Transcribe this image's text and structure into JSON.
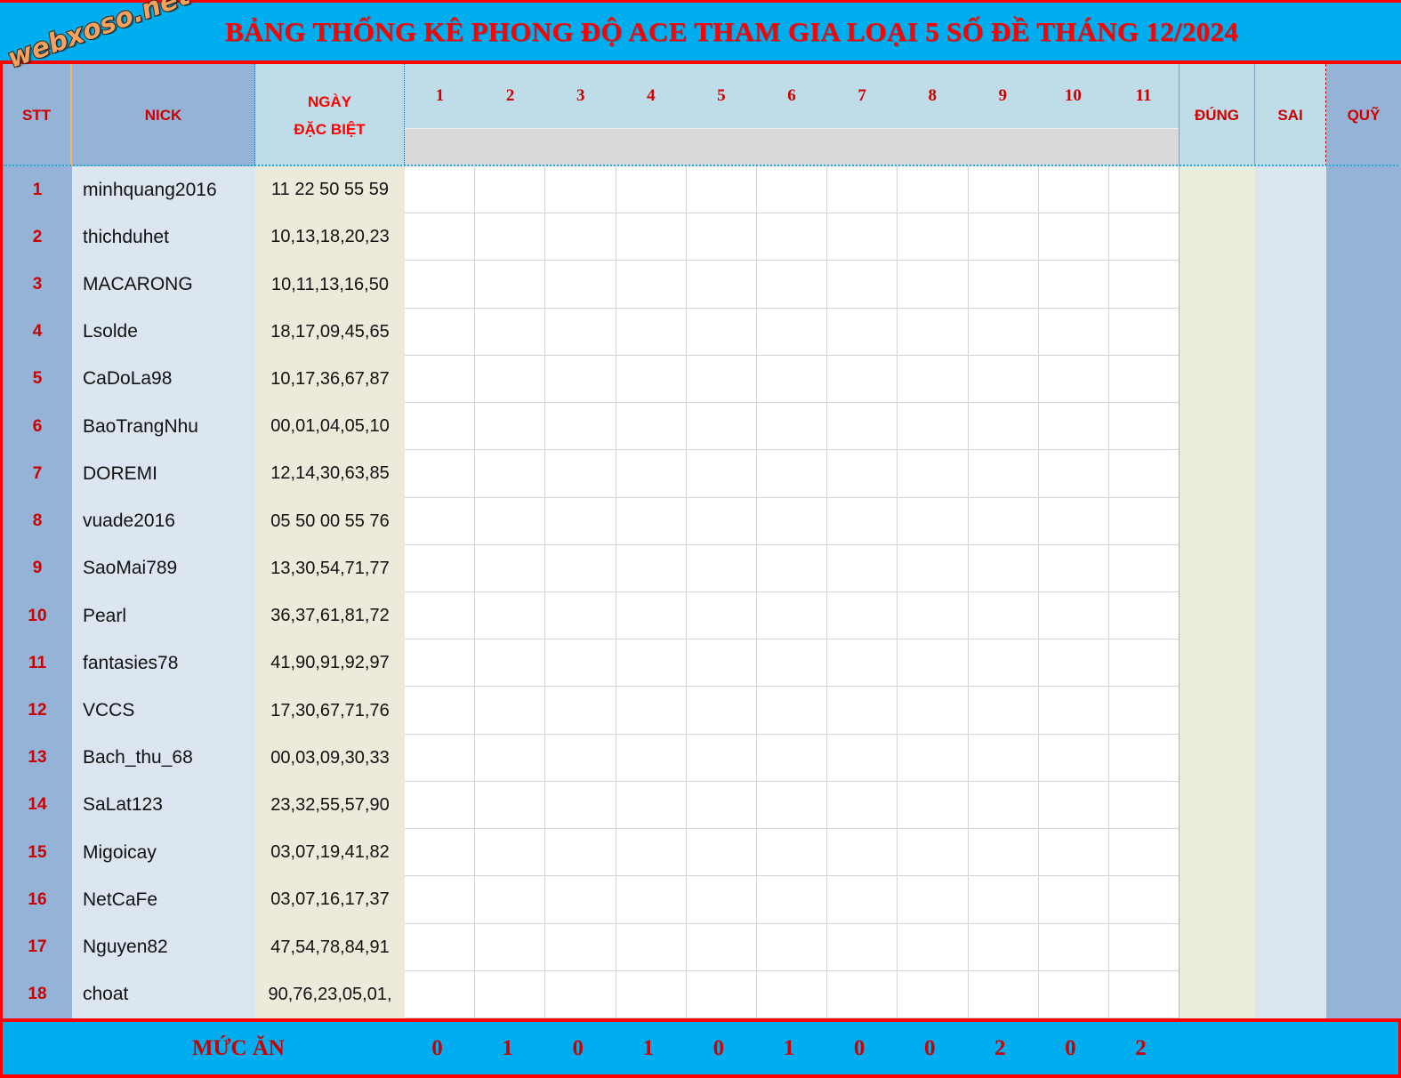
{
  "watermark": {
    "text": "webxoso.net"
  },
  "title": "BẢNG THỐNG KÊ PHONG ĐỘ ACE THAM GIA LOẠI 5 SỐ ĐỀ THÁNG 12/2024",
  "header": {
    "stt": "STT",
    "nick": "NICK",
    "ngay_line1": "NGÀY",
    "ngay_line2": "ĐẶC BIỆT",
    "day_columns": [
      "1",
      "2",
      "3",
      "4",
      "5",
      "6",
      "7",
      "8",
      "9",
      "10",
      "11"
    ],
    "dung": "ĐÚNG",
    "sai": "SAI",
    "quy": "QUỸ"
  },
  "rows": [
    {
      "stt": "1",
      "nick": "minhquang2016",
      "ngay": "11 22 50 55 59",
      "dung": "",
      "sai": "",
      "quy": ""
    },
    {
      "stt": "2",
      "nick": "thichduhet",
      "ngay": "10,13,18,20,23",
      "dung": "",
      "sai": "",
      "quy": ""
    },
    {
      "stt": "3",
      "nick": "MACARONG",
      "ngay": "10,11,13,16,50",
      "dung": "",
      "sai": "",
      "quy": ""
    },
    {
      "stt": "4",
      "nick": "Lsolde",
      "ngay": "18,17,09,45,65",
      "dung": "",
      "sai": "",
      "quy": ""
    },
    {
      "stt": "5",
      "nick": "CaDoLa98",
      "ngay": "10,17,36,67,87",
      "dung": "",
      "sai": "",
      "quy": ""
    },
    {
      "stt": "6",
      "nick": "BaoTrangNhu",
      "ngay": "00,01,04,05,10",
      "dung": "",
      "sai": "",
      "quy": ""
    },
    {
      "stt": "7",
      "nick": "DOREMI",
      "ngay": "12,14,30,63,85",
      "dung": "",
      "sai": "",
      "quy": ""
    },
    {
      "stt": "8",
      "nick": "vuade2016",
      "ngay": "05 50 00 55 76",
      "dung": "",
      "sai": "",
      "quy": ""
    },
    {
      "stt": "9",
      "nick": "SaoMai789",
      "ngay": "13,30,54,71,77",
      "dung": "",
      "sai": "",
      "quy": ""
    },
    {
      "stt": "10",
      "nick": "Pearl",
      "ngay": "36,37,61,81,72",
      "dung": "",
      "sai": "",
      "quy": ""
    },
    {
      "stt": "11",
      "nick": "fantasies78",
      "ngay": "41,90,91,92,97",
      "dung": "",
      "sai": "",
      "quy": ""
    },
    {
      "stt": "12",
      "nick": "VCCS",
      "ngay": "17,30,67,71,76",
      "dung": "",
      "sai": "",
      "quy": ""
    },
    {
      "stt": "13",
      "nick": "Bach_thu_68",
      "ngay": "00,03,09,30,33",
      "dung": "",
      "sai": "",
      "quy": ""
    },
    {
      "stt": "14",
      "nick": "SaLat123",
      "ngay": "23,32,55,57,90",
      "dung": "",
      "sai": "",
      "quy": ""
    },
    {
      "stt": "15",
      "nick": "Migoicay",
      "ngay": "03,07,19,41,82",
      "dung": "",
      "sai": "",
      "quy": ""
    },
    {
      "stt": "16",
      "nick": "NetCaFe",
      "ngay": "03,07,16,17,37",
      "dung": "",
      "sai": "",
      "quy": ""
    },
    {
      "stt": "17",
      "nick": "Nguyen82",
      "ngay": "47,54,78,84,91",
      "dung": "",
      "sai": "",
      "quy": ""
    },
    {
      "stt": "18",
      "nick": "choat",
      "ngay": "90,76,23,05,01,",
      "dung": "",
      "sai": "",
      "quy": ""
    }
  ],
  "footer": {
    "label": "MỨC ĂN",
    "values": [
      "0",
      "1",
      "0",
      "1",
      "0",
      "1",
      "0",
      "0",
      "2",
      "0",
      "2"
    ]
  },
  "colors": {
    "title_bar": "#00AEEF",
    "title_text": "#FF0000",
    "border_red": "#FF0000",
    "header_blue": "#95B3D7",
    "header_light_blue": "#BFDDE8",
    "grey_band": "#D9D9D9",
    "nick_cell": "#DCE6F1",
    "ngay_cell": "#EEEADB",
    "dung_cell": "#E8EEDB",
    "quy_cell": "#95B3D7",
    "stt_text": "#CC0000",
    "watermark": "#F4A261"
  }
}
